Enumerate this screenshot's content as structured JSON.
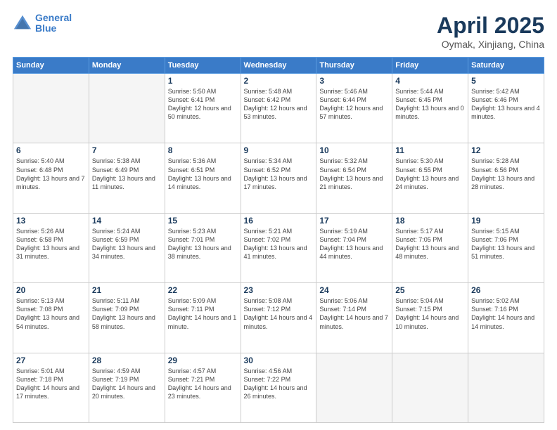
{
  "header": {
    "logo_line1": "General",
    "logo_line2": "Blue",
    "title": "April 2025",
    "subtitle": "Oymak, Xinjiang, China"
  },
  "weekdays": [
    "Sunday",
    "Monday",
    "Tuesday",
    "Wednesday",
    "Thursday",
    "Friday",
    "Saturday"
  ],
  "weeks": [
    [
      {
        "day": "",
        "info": ""
      },
      {
        "day": "",
        "info": ""
      },
      {
        "day": "1",
        "info": "Sunrise: 5:50 AM\nSunset: 6:41 PM\nDaylight: 12 hours\nand 50 minutes."
      },
      {
        "day": "2",
        "info": "Sunrise: 5:48 AM\nSunset: 6:42 PM\nDaylight: 12 hours\nand 53 minutes."
      },
      {
        "day": "3",
        "info": "Sunrise: 5:46 AM\nSunset: 6:44 PM\nDaylight: 12 hours\nand 57 minutes."
      },
      {
        "day": "4",
        "info": "Sunrise: 5:44 AM\nSunset: 6:45 PM\nDaylight: 13 hours\nand 0 minutes."
      },
      {
        "day": "5",
        "info": "Sunrise: 5:42 AM\nSunset: 6:46 PM\nDaylight: 13 hours\nand 4 minutes."
      }
    ],
    [
      {
        "day": "6",
        "info": "Sunrise: 5:40 AM\nSunset: 6:48 PM\nDaylight: 13 hours\nand 7 minutes."
      },
      {
        "day": "7",
        "info": "Sunrise: 5:38 AM\nSunset: 6:49 PM\nDaylight: 13 hours\nand 11 minutes."
      },
      {
        "day": "8",
        "info": "Sunrise: 5:36 AM\nSunset: 6:51 PM\nDaylight: 13 hours\nand 14 minutes."
      },
      {
        "day": "9",
        "info": "Sunrise: 5:34 AM\nSunset: 6:52 PM\nDaylight: 13 hours\nand 17 minutes."
      },
      {
        "day": "10",
        "info": "Sunrise: 5:32 AM\nSunset: 6:54 PM\nDaylight: 13 hours\nand 21 minutes."
      },
      {
        "day": "11",
        "info": "Sunrise: 5:30 AM\nSunset: 6:55 PM\nDaylight: 13 hours\nand 24 minutes."
      },
      {
        "day": "12",
        "info": "Sunrise: 5:28 AM\nSunset: 6:56 PM\nDaylight: 13 hours\nand 28 minutes."
      }
    ],
    [
      {
        "day": "13",
        "info": "Sunrise: 5:26 AM\nSunset: 6:58 PM\nDaylight: 13 hours\nand 31 minutes."
      },
      {
        "day": "14",
        "info": "Sunrise: 5:24 AM\nSunset: 6:59 PM\nDaylight: 13 hours\nand 34 minutes."
      },
      {
        "day": "15",
        "info": "Sunrise: 5:23 AM\nSunset: 7:01 PM\nDaylight: 13 hours\nand 38 minutes."
      },
      {
        "day": "16",
        "info": "Sunrise: 5:21 AM\nSunset: 7:02 PM\nDaylight: 13 hours\nand 41 minutes."
      },
      {
        "day": "17",
        "info": "Sunrise: 5:19 AM\nSunset: 7:04 PM\nDaylight: 13 hours\nand 44 minutes."
      },
      {
        "day": "18",
        "info": "Sunrise: 5:17 AM\nSunset: 7:05 PM\nDaylight: 13 hours\nand 48 minutes."
      },
      {
        "day": "19",
        "info": "Sunrise: 5:15 AM\nSunset: 7:06 PM\nDaylight: 13 hours\nand 51 minutes."
      }
    ],
    [
      {
        "day": "20",
        "info": "Sunrise: 5:13 AM\nSunset: 7:08 PM\nDaylight: 13 hours\nand 54 minutes."
      },
      {
        "day": "21",
        "info": "Sunrise: 5:11 AM\nSunset: 7:09 PM\nDaylight: 13 hours\nand 58 minutes."
      },
      {
        "day": "22",
        "info": "Sunrise: 5:09 AM\nSunset: 7:11 PM\nDaylight: 14 hours\nand 1 minute."
      },
      {
        "day": "23",
        "info": "Sunrise: 5:08 AM\nSunset: 7:12 PM\nDaylight: 14 hours\nand 4 minutes."
      },
      {
        "day": "24",
        "info": "Sunrise: 5:06 AM\nSunset: 7:14 PM\nDaylight: 14 hours\nand 7 minutes."
      },
      {
        "day": "25",
        "info": "Sunrise: 5:04 AM\nSunset: 7:15 PM\nDaylight: 14 hours\nand 10 minutes."
      },
      {
        "day": "26",
        "info": "Sunrise: 5:02 AM\nSunset: 7:16 PM\nDaylight: 14 hours\nand 14 minutes."
      }
    ],
    [
      {
        "day": "27",
        "info": "Sunrise: 5:01 AM\nSunset: 7:18 PM\nDaylight: 14 hours\nand 17 minutes."
      },
      {
        "day": "28",
        "info": "Sunrise: 4:59 AM\nSunset: 7:19 PM\nDaylight: 14 hours\nand 20 minutes."
      },
      {
        "day": "29",
        "info": "Sunrise: 4:57 AM\nSunset: 7:21 PM\nDaylight: 14 hours\nand 23 minutes."
      },
      {
        "day": "30",
        "info": "Sunrise: 4:56 AM\nSunset: 7:22 PM\nDaylight: 14 hours\nand 26 minutes."
      },
      {
        "day": "",
        "info": ""
      },
      {
        "day": "",
        "info": ""
      },
      {
        "day": "",
        "info": ""
      }
    ]
  ]
}
